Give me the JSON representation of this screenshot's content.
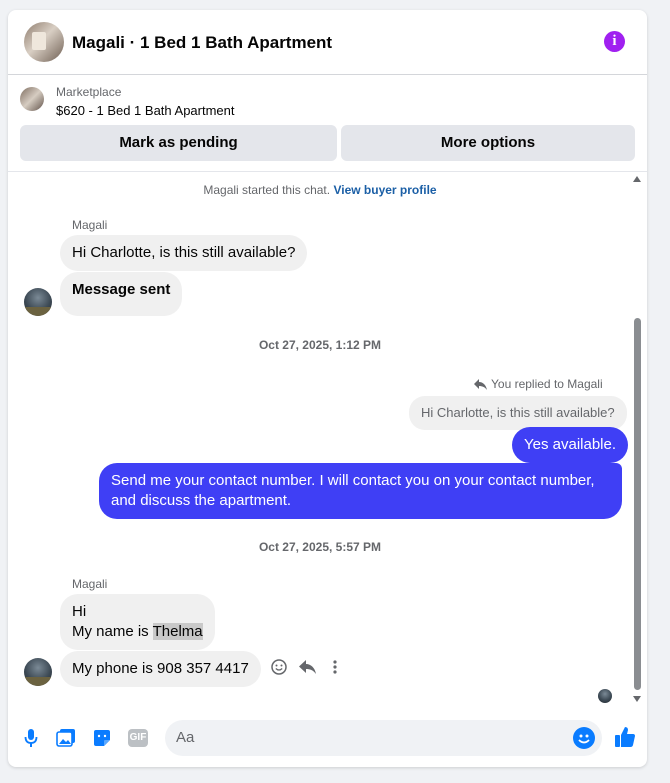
{
  "header": {
    "title": "Magali · 1 Bed 1 Bath Apartment",
    "info_icon": "info-icon"
  },
  "listing": {
    "source": "Marketplace",
    "price_title": "$620 - 1 Bed 1 Bath Apartment"
  },
  "actions": {
    "mark_pending": "Mark as pending",
    "more_options": "More options"
  },
  "chat": {
    "system_note": "Magali started this chat.",
    "view_buyer_profile": "View buyer profile",
    "messages": [
      {
        "sender": "Magali",
        "text": "Hi Charlotte, is this still available?"
      },
      {
        "text": "Message sent"
      },
      {
        "timestamp": "Oct 27, 2025, 1:12 PM"
      },
      {
        "reply_note": "You replied to Magali",
        "quoted": "Hi Charlotte, is this still available?"
      },
      {
        "text": "Yes available."
      },
      {
        "text": "Send me your contact number. I will contact you on your contact number, and discuss the apartment."
      },
      {
        "timestamp": "Oct 27, 2025, 5:57 PM"
      },
      {
        "sender": "Magali",
        "line1": "Hi",
        "line2_prefix": "My name is ",
        "line2_highlight": "Thelma"
      },
      {
        "text": "My phone is 908 357 4417"
      }
    ]
  },
  "composer": {
    "placeholder": "Aa"
  },
  "colors": {
    "outgoing_bubble": "#3f3ff5",
    "incoming_bubble": "#f0f0f0",
    "accent": "#0a7cff",
    "info": "#a020f0"
  }
}
